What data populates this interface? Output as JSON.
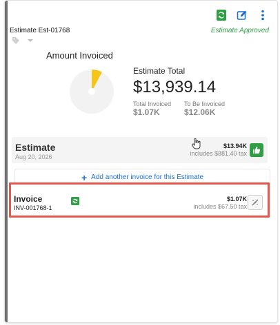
{
  "header": {
    "estimate_number": "Estimate Est-01768",
    "status": "Estimate Approved"
  },
  "icons": {
    "sync": "sync-icon",
    "edit": "edit-icon",
    "more": "more-vertical-icon",
    "tag": "tag-icon",
    "chevron": "chevron-down-icon",
    "thumbs_up": "thumbs-up-icon",
    "no_invoice": "no-invoice-icon",
    "plus": "plus-icon"
  },
  "summary": {
    "amount_invoiced_label": "Amount Invoiced",
    "estimate_total_label": "Estimate Total",
    "estimate_total": "$13,939.14",
    "total_invoiced_label": "Total Invoiced",
    "total_invoiced": "$1.07K",
    "to_be_invoiced_label": "To Be Invoiced",
    "to_be_invoiced": "$12.06K",
    "invoiced_fraction": 0.077
  },
  "estimate_row": {
    "title": "Estimate",
    "date": "Aug 20, 2026",
    "amount": "$13.94K",
    "tax": "includes $881.40 tax"
  },
  "add_invoice_label": "Add another invoice for this Estimate",
  "invoice_row": {
    "title": "Invoice",
    "number": "INV-001768-1",
    "amount": "$1.07K",
    "tax": "includes $67.50 tax"
  },
  "colors": {
    "green": "#2f9e44",
    "blue": "#1c6fd1",
    "highlight": "#e4584b",
    "pie_fill": "#f5c518"
  }
}
